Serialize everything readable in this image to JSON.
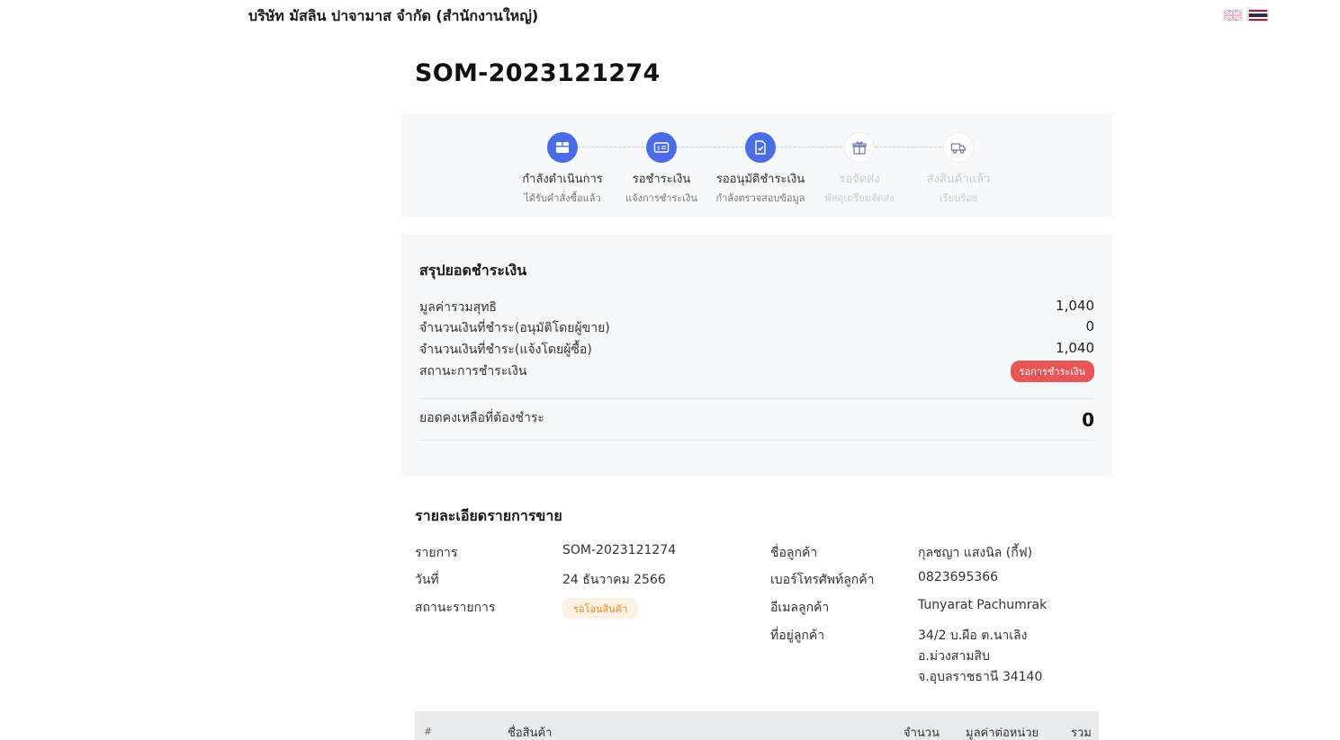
{
  "header": {
    "company_name": "บริษัท มัสลิน ปาจามาส จำกัด (สำนักงานใหญ่)",
    "languages": [
      "en",
      "th"
    ]
  },
  "order": {
    "number": "SOM-2023121274"
  },
  "steps": [
    {
      "label": "กำลังดำเนินการ",
      "sub": "ได้รับคำสั่งซื้อแล้ว",
      "icon": "box-icon",
      "active": true
    },
    {
      "label": "รอชำระเงิน",
      "sub": "แจ้งการชำระเงิน",
      "icon": "payment-card-icon",
      "active": true
    },
    {
      "label": "รออนุมัติชำระเงิน",
      "sub": "กำลังตรวจสอบข้อมูล",
      "icon": "document-check-icon",
      "active": true
    },
    {
      "label": "รอจัดส่ง",
      "sub": "พัสดุเตรียมจัดส่ง",
      "icon": "gift-box-icon",
      "active": false
    },
    {
      "label": "ส่งสินค้าแล้ว",
      "sub": "เรียบร้อย",
      "icon": "truck-icon",
      "active": false
    }
  ],
  "summary": {
    "title": "สรุปยอดชำระเงิน",
    "rows": [
      {
        "label": "มูลค่ารวมสุทธิ",
        "value": "1,040"
      },
      {
        "label": "จำนวนเงินที่ชำระ(อนุมัติโดยผู้ขาย)",
        "value": "0"
      },
      {
        "label": "จำนวนเงินที่ชำระ(แจ้งโดยผู้ซื้อ)",
        "value": "1,040"
      }
    ],
    "status_label": "สถานะการชำระเงิน",
    "status_badge": "รอการชำระเงิน",
    "remaining_label": "ยอดคงเหลือที่ต้องชำระ",
    "remaining_value": "0"
  },
  "details": {
    "title": "รายละเอียดรายการขาย",
    "order_label": "รายการ",
    "order_value": "SOM-2023121274",
    "date_label": "วันที่",
    "date_value": "24 ธันวาคม 2566",
    "status_label": "สถานะรายการ",
    "status_badge": "รอโอนสินค้า",
    "customer_name_label": "ชื่อลูกค้า",
    "customer_name_value": "กุลชญา แสงนิล (กี้ฟ)",
    "phone_label": "เบอร์โทรศัพท์ลูกค้า",
    "phone_value": "0823695366",
    "email_label": "อีเมลลูกค้า",
    "email_value": "Tunyarat Pachumrak",
    "address_label": "ที่อยู่ลูกค้า",
    "address_lines": [
      "34/2 บ.ผือ ต.นาเลิง",
      "อ.ม่วงสามสิบ",
      "จ.อุบลราชธานี 34140"
    ]
  },
  "table": {
    "headers": {
      "index": "#",
      "product": "ชื่อสินค้า",
      "qty": "จำนวน",
      "unit_price": "มูลค่าต่อหน่วย",
      "total": "รวม"
    }
  },
  "colors": {
    "accent": "#4a6de5",
    "badge_red": "#e85557",
    "badge_orange_bg": "#fdf1e3",
    "badge_orange_text": "#e58a2b",
    "panel_bg": "#f7f8f9"
  }
}
